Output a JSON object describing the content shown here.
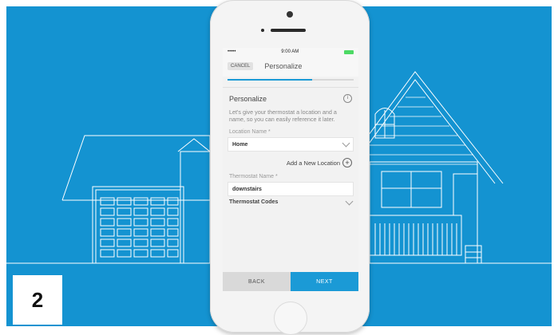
{
  "step_number": "2",
  "colors": {
    "background_blue": "#1493d1",
    "accent": "#1b9ad6",
    "battery": "#4cd964"
  },
  "status_bar": {
    "signal": "•••••",
    "time": "9:00 AM"
  },
  "nav": {
    "cancel_label": "CANCEL",
    "title": "Personalize"
  },
  "progress": {
    "fraction": 0.67
  },
  "section": {
    "title": "Personalize",
    "info_icon": "info-icon",
    "description": "Let's give your thermostat a location and a name, so you can easily reference it later."
  },
  "location": {
    "label": "Location Name *",
    "value": "Home",
    "add_label": "Add a New Location"
  },
  "thermostat": {
    "label": "Thermostat Name *",
    "value": "downstairs",
    "codes_label": "Thermostat Codes"
  },
  "footer": {
    "back_label": "BACK",
    "next_label": "NEXT"
  }
}
